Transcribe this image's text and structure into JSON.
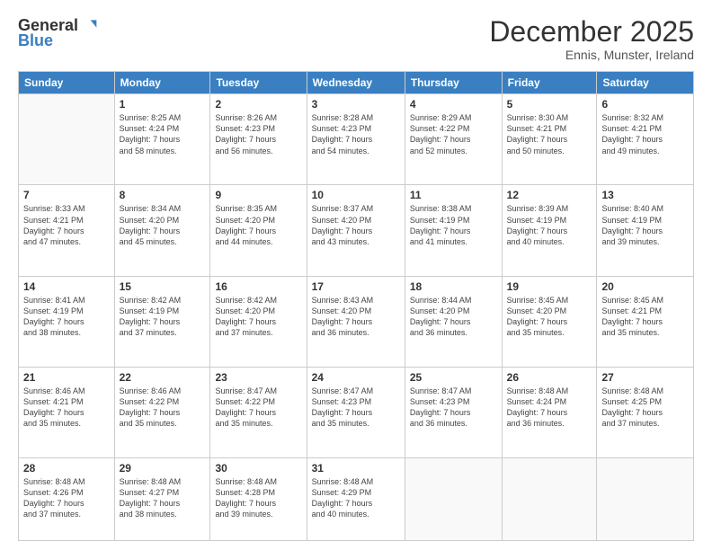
{
  "logo": {
    "general": "General",
    "blue": "Blue"
  },
  "title": "December 2025",
  "location": "Ennis, Munster, Ireland",
  "days_header": [
    "Sunday",
    "Monday",
    "Tuesday",
    "Wednesday",
    "Thursday",
    "Friday",
    "Saturday"
  ],
  "weeks": [
    [
      {
        "day": "",
        "info": ""
      },
      {
        "day": "1",
        "info": "Sunrise: 8:25 AM\nSunset: 4:24 PM\nDaylight: 7 hours\nand 58 minutes."
      },
      {
        "day": "2",
        "info": "Sunrise: 8:26 AM\nSunset: 4:23 PM\nDaylight: 7 hours\nand 56 minutes."
      },
      {
        "day": "3",
        "info": "Sunrise: 8:28 AM\nSunset: 4:23 PM\nDaylight: 7 hours\nand 54 minutes."
      },
      {
        "day": "4",
        "info": "Sunrise: 8:29 AM\nSunset: 4:22 PM\nDaylight: 7 hours\nand 52 minutes."
      },
      {
        "day": "5",
        "info": "Sunrise: 8:30 AM\nSunset: 4:21 PM\nDaylight: 7 hours\nand 50 minutes."
      },
      {
        "day": "6",
        "info": "Sunrise: 8:32 AM\nSunset: 4:21 PM\nDaylight: 7 hours\nand 49 minutes."
      }
    ],
    [
      {
        "day": "7",
        "info": "Sunrise: 8:33 AM\nSunset: 4:21 PM\nDaylight: 7 hours\nand 47 minutes."
      },
      {
        "day": "8",
        "info": "Sunrise: 8:34 AM\nSunset: 4:20 PM\nDaylight: 7 hours\nand 45 minutes."
      },
      {
        "day": "9",
        "info": "Sunrise: 8:35 AM\nSunset: 4:20 PM\nDaylight: 7 hours\nand 44 minutes."
      },
      {
        "day": "10",
        "info": "Sunrise: 8:37 AM\nSunset: 4:20 PM\nDaylight: 7 hours\nand 43 minutes."
      },
      {
        "day": "11",
        "info": "Sunrise: 8:38 AM\nSunset: 4:19 PM\nDaylight: 7 hours\nand 41 minutes."
      },
      {
        "day": "12",
        "info": "Sunrise: 8:39 AM\nSunset: 4:19 PM\nDaylight: 7 hours\nand 40 minutes."
      },
      {
        "day": "13",
        "info": "Sunrise: 8:40 AM\nSunset: 4:19 PM\nDaylight: 7 hours\nand 39 minutes."
      }
    ],
    [
      {
        "day": "14",
        "info": "Sunrise: 8:41 AM\nSunset: 4:19 PM\nDaylight: 7 hours\nand 38 minutes."
      },
      {
        "day": "15",
        "info": "Sunrise: 8:42 AM\nSunset: 4:19 PM\nDaylight: 7 hours\nand 37 minutes."
      },
      {
        "day": "16",
        "info": "Sunrise: 8:42 AM\nSunset: 4:20 PM\nDaylight: 7 hours\nand 37 minutes."
      },
      {
        "day": "17",
        "info": "Sunrise: 8:43 AM\nSunset: 4:20 PM\nDaylight: 7 hours\nand 36 minutes."
      },
      {
        "day": "18",
        "info": "Sunrise: 8:44 AM\nSunset: 4:20 PM\nDaylight: 7 hours\nand 36 minutes."
      },
      {
        "day": "19",
        "info": "Sunrise: 8:45 AM\nSunset: 4:20 PM\nDaylight: 7 hours\nand 35 minutes."
      },
      {
        "day": "20",
        "info": "Sunrise: 8:45 AM\nSunset: 4:21 PM\nDaylight: 7 hours\nand 35 minutes."
      }
    ],
    [
      {
        "day": "21",
        "info": "Sunrise: 8:46 AM\nSunset: 4:21 PM\nDaylight: 7 hours\nand 35 minutes."
      },
      {
        "day": "22",
        "info": "Sunrise: 8:46 AM\nSunset: 4:22 PM\nDaylight: 7 hours\nand 35 minutes."
      },
      {
        "day": "23",
        "info": "Sunrise: 8:47 AM\nSunset: 4:22 PM\nDaylight: 7 hours\nand 35 minutes."
      },
      {
        "day": "24",
        "info": "Sunrise: 8:47 AM\nSunset: 4:23 PM\nDaylight: 7 hours\nand 35 minutes."
      },
      {
        "day": "25",
        "info": "Sunrise: 8:47 AM\nSunset: 4:23 PM\nDaylight: 7 hours\nand 36 minutes."
      },
      {
        "day": "26",
        "info": "Sunrise: 8:48 AM\nSunset: 4:24 PM\nDaylight: 7 hours\nand 36 minutes."
      },
      {
        "day": "27",
        "info": "Sunrise: 8:48 AM\nSunset: 4:25 PM\nDaylight: 7 hours\nand 37 minutes."
      }
    ],
    [
      {
        "day": "28",
        "info": "Sunrise: 8:48 AM\nSunset: 4:26 PM\nDaylight: 7 hours\nand 37 minutes."
      },
      {
        "day": "29",
        "info": "Sunrise: 8:48 AM\nSunset: 4:27 PM\nDaylight: 7 hours\nand 38 minutes."
      },
      {
        "day": "30",
        "info": "Sunrise: 8:48 AM\nSunset: 4:28 PM\nDaylight: 7 hours\nand 39 minutes."
      },
      {
        "day": "31",
        "info": "Sunrise: 8:48 AM\nSunset: 4:29 PM\nDaylight: 7 hours\nand 40 minutes."
      },
      {
        "day": "",
        "info": ""
      },
      {
        "day": "",
        "info": ""
      },
      {
        "day": "",
        "info": ""
      }
    ]
  ]
}
